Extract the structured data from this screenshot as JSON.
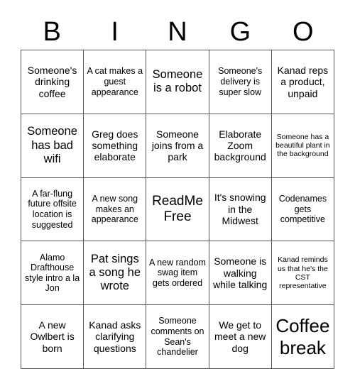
{
  "card": {
    "title": "BINGO",
    "header_letters": [
      "B",
      "I",
      "N",
      "G",
      "O"
    ],
    "grid_size": "5x5",
    "border_color": "#555555",
    "background_color": "#ffffff",
    "text_color": "#000000",
    "cells": [
      {
        "text": "Someone's drinking coffee",
        "size": "sz-m",
        "row": 1,
        "col": 1
      },
      {
        "text": "A cat makes a guest appearance",
        "size": "sz-s",
        "row": 1,
        "col": 2
      },
      {
        "text": "Someone is a robot",
        "size": "sz-l",
        "row": 1,
        "col": 3
      },
      {
        "text": "Someone's delivery is super slow",
        "size": "sz-s",
        "row": 1,
        "col": 4
      },
      {
        "text": "Kanad reps a product, unpaid",
        "size": "sz-m",
        "row": 1,
        "col": 5
      },
      {
        "text": "Someone has bad wifi",
        "size": "sz-l",
        "row": 2,
        "col": 1
      },
      {
        "text": "Greg does something elaborate",
        "size": "sz-m",
        "row": 2,
        "col": 2
      },
      {
        "text": "Someone joins from a park",
        "size": "sz-m",
        "row": 2,
        "col": 3
      },
      {
        "text": "Elaborate Zoom background",
        "size": "sz-m",
        "row": 2,
        "col": 4
      },
      {
        "text": "Someone has a beautiful plant in the background",
        "size": "sz-xs",
        "row": 2,
        "col": 5
      },
      {
        "text": "A far-flung future offsite location is suggested",
        "size": "sz-s",
        "row": 3,
        "col": 1
      },
      {
        "text": "A new song makes an appearance",
        "size": "sz-s",
        "row": 3,
        "col": 2
      },
      {
        "text": "ReadMe Free",
        "size": "sz-xl",
        "row": 3,
        "col": 3
      },
      {
        "text": "It's snowing in the Midwest",
        "size": "sz-m",
        "row": 3,
        "col": 4
      },
      {
        "text": "Codenames gets competitive",
        "size": "sz-s",
        "row": 3,
        "col": 5
      },
      {
        "text": "Alamo Drafthouse style intro a la Jon",
        "size": "sz-s",
        "row": 4,
        "col": 1
      },
      {
        "text": "Pat sings a song he wrote",
        "size": "sz-l",
        "row": 4,
        "col": 2
      },
      {
        "text": "A new random swag item gets ordered",
        "size": "sz-s",
        "row": 4,
        "col": 3
      },
      {
        "text": "Someone is walking while talking",
        "size": "sz-m",
        "row": 4,
        "col": 4
      },
      {
        "text": "Kanad reminds us that he's the CST representative",
        "size": "sz-xs",
        "row": 4,
        "col": 5
      },
      {
        "text": "A new Owlbert is born",
        "size": "sz-m",
        "row": 5,
        "col": 1
      },
      {
        "text": "Kanad asks clarifying questions",
        "size": "sz-m",
        "row": 5,
        "col": 2
      },
      {
        "text": "Someone comments on Sean's chandelier",
        "size": "sz-s",
        "row": 5,
        "col": 3
      },
      {
        "text": "We get to meet a new dog",
        "size": "sz-m",
        "row": 5,
        "col": 4
      },
      {
        "text": "Coffee break",
        "size": "sz-xxl",
        "row": 5,
        "col": 5
      }
    ]
  }
}
